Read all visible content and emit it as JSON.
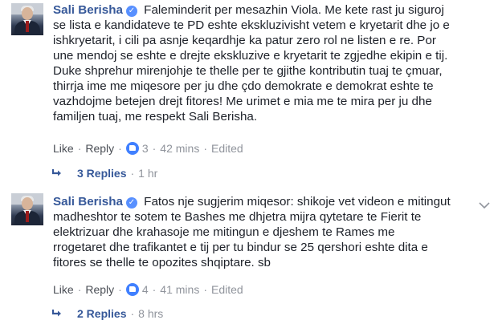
{
  "comments": [
    {
      "author": "Sali Berisha",
      "verified_icon": "verified-badge-icon",
      "text": " Faleminderit per mesazhin Viola. Me kete rast ju siguroj\nse lista e kandidateve te PD eshte ekskluzivisht vetem e kryetarit dhe jo e\nishkryetarit, i cili pa asnje keqardhje ka patur zero rol ne listen e re. Por\nune mendoj se eshte e drejte ekskluzive e kryetarit te zgjedhe ekipin e tij.\nDuke shprehur mirenjohje te thelle per te gjithe kontributin tuaj te çmuar,\nthirrja ime me miqesore per ju dhe çdo demokrate e demokrat eshte te\nvazhdojme betejen drejt fitores! Me urimet e mia me te mira per ju dhe\nfamiljen tuaj, me respekt Sali Berisha.",
      "like_label": "Like",
      "reply_label": "Reply",
      "like_count": "3",
      "time": "42 mins",
      "edited": "Edited",
      "replies_count": "3 Replies",
      "replies_time": "1 hr"
    },
    {
      "author": "Sali Berisha",
      "verified_icon": "verified-badge-icon",
      "text": " Fatos nje sugjerim miqesor: shikoje vet videon e mitingut\nmadheshtor te sotem te Bashes me dhjetra mijra qytetare te Fierit te\nelektrizuar dhe krahasoje me mitingun e djeshem te Rames me\nrrogetaret dhe trafikantet e tij per tu bindur se 25 qershori eshte dita e\nfitores se thelle te opozites shqiptare. sb",
      "like_label": "Like",
      "reply_label": "Reply",
      "like_count": "4",
      "time": "41 mins",
      "edited": "Edited",
      "replies_count": "2 Replies",
      "replies_time": "8 hrs"
    }
  ],
  "colors": {
    "author": "#365899",
    "text": "#1d2129",
    "muted": "#90949c",
    "like_icon": "#4080ff"
  }
}
